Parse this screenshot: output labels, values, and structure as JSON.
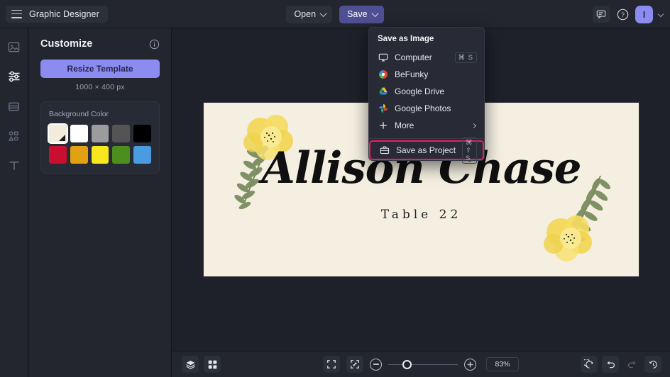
{
  "app": {
    "brand_label": "Graphic Designer",
    "hamburger_icon": "hamburger-menu-icon"
  },
  "topbar": {
    "open_label": "Open",
    "save_label": "Save",
    "feedback_icon": "chat-bubble-icon",
    "help_icon": "question-circle-icon",
    "avatar_initial": "I"
  },
  "rail": {
    "items": [
      {
        "icon": "image-icon",
        "name": "sidebar-item-image",
        "active": false
      },
      {
        "icon": "sliders-icon",
        "name": "sidebar-item-customize",
        "active": true
      },
      {
        "icon": "template-icon",
        "name": "sidebar-item-templates",
        "active": false
      },
      {
        "icon": "graphics-icon",
        "name": "sidebar-item-graphics",
        "active": false
      },
      {
        "icon": "text-icon",
        "name": "sidebar-item-text",
        "active": false
      }
    ]
  },
  "panel": {
    "title": "Customize",
    "info_icon": "info-circle-icon",
    "resize_label": "Resize Template",
    "dimensions": "1000 × 400 px",
    "background_color_label": "Background Color",
    "swatches": [
      {
        "name": "swatch-cream",
        "color": "#f3ecdc",
        "selected": true
      },
      {
        "name": "swatch-white",
        "color": "#ffffff",
        "selected": false
      },
      {
        "name": "swatch-gray",
        "color": "#9c9c9c",
        "selected": false
      },
      {
        "name": "swatch-darkgray",
        "color": "#545454",
        "selected": false
      },
      {
        "name": "swatch-black",
        "color": "#000000",
        "selected": false
      },
      {
        "name": "swatch-crimson",
        "color": "#c8102e",
        "selected": false
      },
      {
        "name": "swatch-orange",
        "color": "#e2a013",
        "selected": false
      },
      {
        "name": "swatch-yellow",
        "color": "#f7e620",
        "selected": false
      },
      {
        "name": "swatch-green",
        "color": "#4d8f1c",
        "selected": false
      },
      {
        "name": "swatch-blue",
        "color": "#4a9bdf",
        "selected": false
      }
    ]
  },
  "save_menu": {
    "heading": "Save as Image",
    "items": [
      {
        "label": "Computer",
        "icon": "monitor-icon",
        "shortcut": "⌘ S",
        "arrow": false
      },
      {
        "label": "BeFunky",
        "icon": "befunky-logo-icon",
        "shortcut": "",
        "arrow": false
      },
      {
        "label": "Google Drive",
        "icon": "google-drive-icon",
        "shortcut": "",
        "arrow": false
      },
      {
        "label": "Google Photos",
        "icon": "google-photos-icon",
        "shortcut": "",
        "arrow": false
      },
      {
        "label": "More",
        "icon": "plus-icon",
        "shortcut": "",
        "arrow": true
      }
    ],
    "project_item": {
      "label": "Save as Project",
      "icon": "briefcase-icon",
      "shortcut": "⌘ ⇧ S",
      "highlight_color": "#e91e63"
    }
  },
  "canvas": {
    "background_color": "#f5efe1",
    "name_text": "Allison Chase",
    "table_text": "Table 22",
    "flower_top_left": "watercolor-yellow-flower-icon",
    "flower_bottom_right": "watercolor-yellow-flower-icon"
  },
  "bottombar": {
    "layers_icon": "layers-icon",
    "pages_icon": "grid-pages-icon",
    "fit_icon": "fit-to-screen-icon",
    "shrink_icon": "zoom-to-fit-icon",
    "zoom_out_icon": "zoom-out-icon",
    "zoom_in_icon": "zoom-in-icon",
    "zoom_value": "83%",
    "reset_icon": "reset-icon",
    "undo_icon": "undo-icon",
    "redo_icon": "redo-icon",
    "history_icon": "history-icon"
  }
}
